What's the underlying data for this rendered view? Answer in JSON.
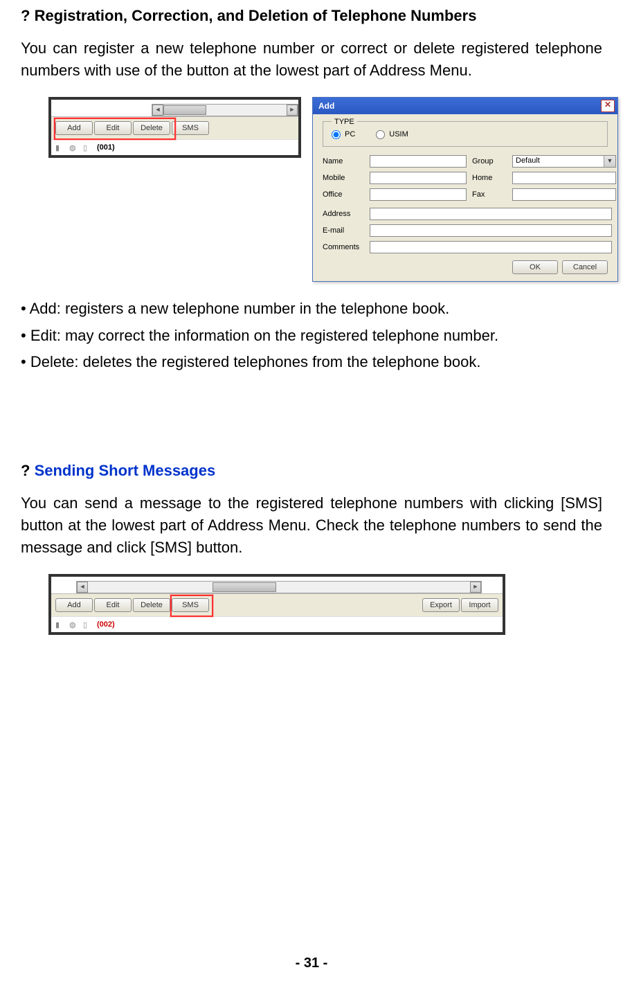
{
  "section1": {
    "title_prefix": "?",
    "title": "Registration, Correction, and Deletion of Telephone Numbers",
    "paragraph": "You can register a new telephone number or correct or delete registered telephone numbers with use of the button at the lowest part of Address Menu."
  },
  "toolbar1": {
    "buttons": {
      "add": "Add",
      "edit": "Edit",
      "delete": "Delete",
      "sms": "SMS"
    },
    "status_count": "(001)"
  },
  "add_dialog": {
    "title": "Add",
    "type_legend": "TYPE",
    "radio": {
      "pc": "PC",
      "usim": "USIM"
    },
    "labels": {
      "name": "Name",
      "group": "Group",
      "mobile": "Mobile",
      "home": "Home",
      "office": "Office",
      "fax": "Fax",
      "address": "Address",
      "email": "E-mail",
      "comments": "Comments"
    },
    "group_value": "Default",
    "buttons": {
      "ok": "OK",
      "cancel": "Cancel"
    }
  },
  "bullets": {
    "add": "• Add: registers a new telephone number in the telephone book.",
    "edit": "• Edit: may correct the information on the registered telephone number.",
    "delete": "• Delete: deletes the registered telephones from the telephone book."
  },
  "section2": {
    "title_prefix": "?",
    "title": "Sending Short Messages",
    "paragraph": "You can send a message to the registered telephone numbers with clicking [SMS] button at the lowest part of Address Menu. Check the telephone numbers to send the message and click [SMS] button."
  },
  "toolbar2": {
    "buttons": {
      "add": "Add",
      "edit": "Edit",
      "delete": "Delete",
      "sms": "SMS",
      "export": "Export",
      "import": "Import"
    },
    "status_count": "(002)"
  },
  "page_number": "- 31 -"
}
